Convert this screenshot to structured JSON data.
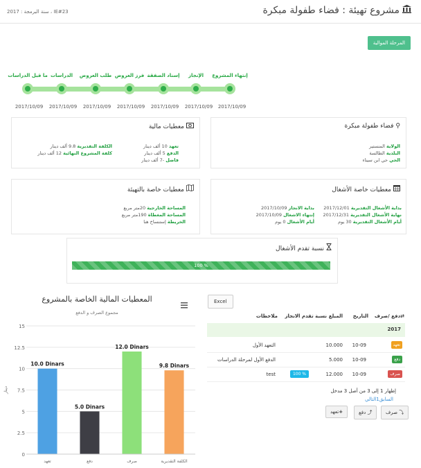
{
  "header": {
    "title": "مشروع تهيئة : فضاء طفولة مبكرة",
    "meta": "IE#23 ، سنة البرمجة : 2017",
    "phase_button": "المرحلة الموالية"
  },
  "timeline": {
    "steps": [
      "إنتهاء المشروع",
      "الإنجاز",
      "إسناد الصفقة",
      "فرز العروض",
      "طلب العروض",
      "الدراسات",
      "ما قبل الدراسات"
    ],
    "dates": [
      "2017/10/09",
      "2017/10/09",
      "2017/10/09",
      "2017/10/09",
      "2017/10/09",
      "2017/10/09",
      "2017/10/09"
    ]
  },
  "panel_location": {
    "title": "فضاء طفولة مبكرة",
    "rows": [
      {
        "label": "الولاية",
        "value": "المنستير"
      },
      {
        "label": "البلدية",
        "value": "الطالسة"
      },
      {
        "label": "الحي",
        "value": "حي ابن سيناء"
      }
    ]
  },
  "panel_finance": {
    "title": "معطيات مالية",
    "right": [
      {
        "label": "تعهد",
        "value": "10 ألف دينار"
      },
      {
        "label": "الدفع",
        "value": "5 ألف دينار"
      },
      {
        "label": "فاضل",
        "value": "-7 ألف دينار"
      }
    ],
    "left": [
      {
        "label": "الكلفة التقديرية",
        "value": "9.8 ألف دينار"
      },
      {
        "label": "كلفة المشروع النهائية",
        "value": "12 ألف دينار"
      }
    ]
  },
  "panel_works": {
    "title": "معطيات خاصة الأشغال",
    "right": [
      {
        "label": "بداية الأشغال التقديرية",
        "value": "2017/12/01"
      },
      {
        "label": "نهاية الأشغال التقديرية",
        "value": "2017/12/31"
      },
      {
        "label": "أيام الأشغال التقديرية",
        "value": "30 يوم"
      }
    ],
    "left": [
      {
        "label": "بداية الانجاز",
        "value": "2017/10/09"
      },
      {
        "label": "إنتهاء الاشغال",
        "value": "2017/10/09"
      },
      {
        "label": "أيام الأشغال",
        "value": "0 يوم"
      }
    ]
  },
  "panel_equip": {
    "title": "معطيات خاصة بالتهيئة",
    "rows": [
      {
        "label": "المساحة الخارجية",
        "value": "20متر مربع"
      },
      {
        "label": "المساحة المغطاة",
        "value": "190متر مربع"
      },
      {
        "label": "الخريطة",
        "value": "إستنساخ هنا"
      }
    ]
  },
  "progress": {
    "title": "نسبة تقدم الأشغال",
    "value_label": "100 %",
    "value": 100
  },
  "table": {
    "excel_label": "Excel",
    "headers": {
      "type": "دفع /صرف",
      "date": "التاريخ",
      "amount": "المبلغ",
      "progress": "نسبة تقدم الانجاز",
      "notes": "ملاحظات"
    },
    "year": "2017",
    "rows": [
      {
        "badge": "تعهد",
        "badge_color": "#f0a020",
        "date": "10-09",
        "amount": "10.000",
        "progress": "",
        "notes": "التعهد الأول"
      },
      {
        "badge": "دفع",
        "badge_color": "#3aa14a",
        "date": "10-09",
        "amount": "5.000",
        "progress": "",
        "notes": "الدفع الأول لمرحلة الدراسات"
      },
      {
        "badge": "صرف",
        "badge_color": "#d9534f",
        "date": "10-09",
        "amount": "12.000",
        "progress": "100 %",
        "notes": "test"
      }
    ],
    "info": "إظهار 1 إلى 3 من أصل 3 مدخل",
    "pager": "السابق1التالي",
    "buttons": {
      "spend": "صرف",
      "pay": "دفع",
      "commit": "تعهد"
    }
  },
  "chart_data": {
    "type": "bar",
    "title": "المعطيات المالية الخاصة بالمشروع",
    "subtitle": "مجموع الصرف و الدفع",
    "ylabel": "دينار",
    "ylim": [
      0,
      15
    ],
    "yticks": [
      "0",
      "2.5",
      "5",
      "7.5",
      "10",
      "12.5",
      "15"
    ],
    "categories": [
      "تعهد",
      "دفع",
      "صرف",
      "الكلفة التقديرية"
    ],
    "values": [
      10.0,
      5.0,
      12.0,
      9.8
    ],
    "data_labels": [
      "10.0 Dinars",
      "5.0 Dinars",
      "12.0 Dinars",
      "9.8 Dinars"
    ],
    "colors": [
      "#4ea1e3",
      "#3e3e45",
      "#8de07a",
      "#f6a45c"
    ],
    "grid": true,
    "legend": "none"
  },
  "colors": {
    "accent": "#4fc08d",
    "green": "#1e9e3e",
    "timeline": "#a6e39d"
  }
}
